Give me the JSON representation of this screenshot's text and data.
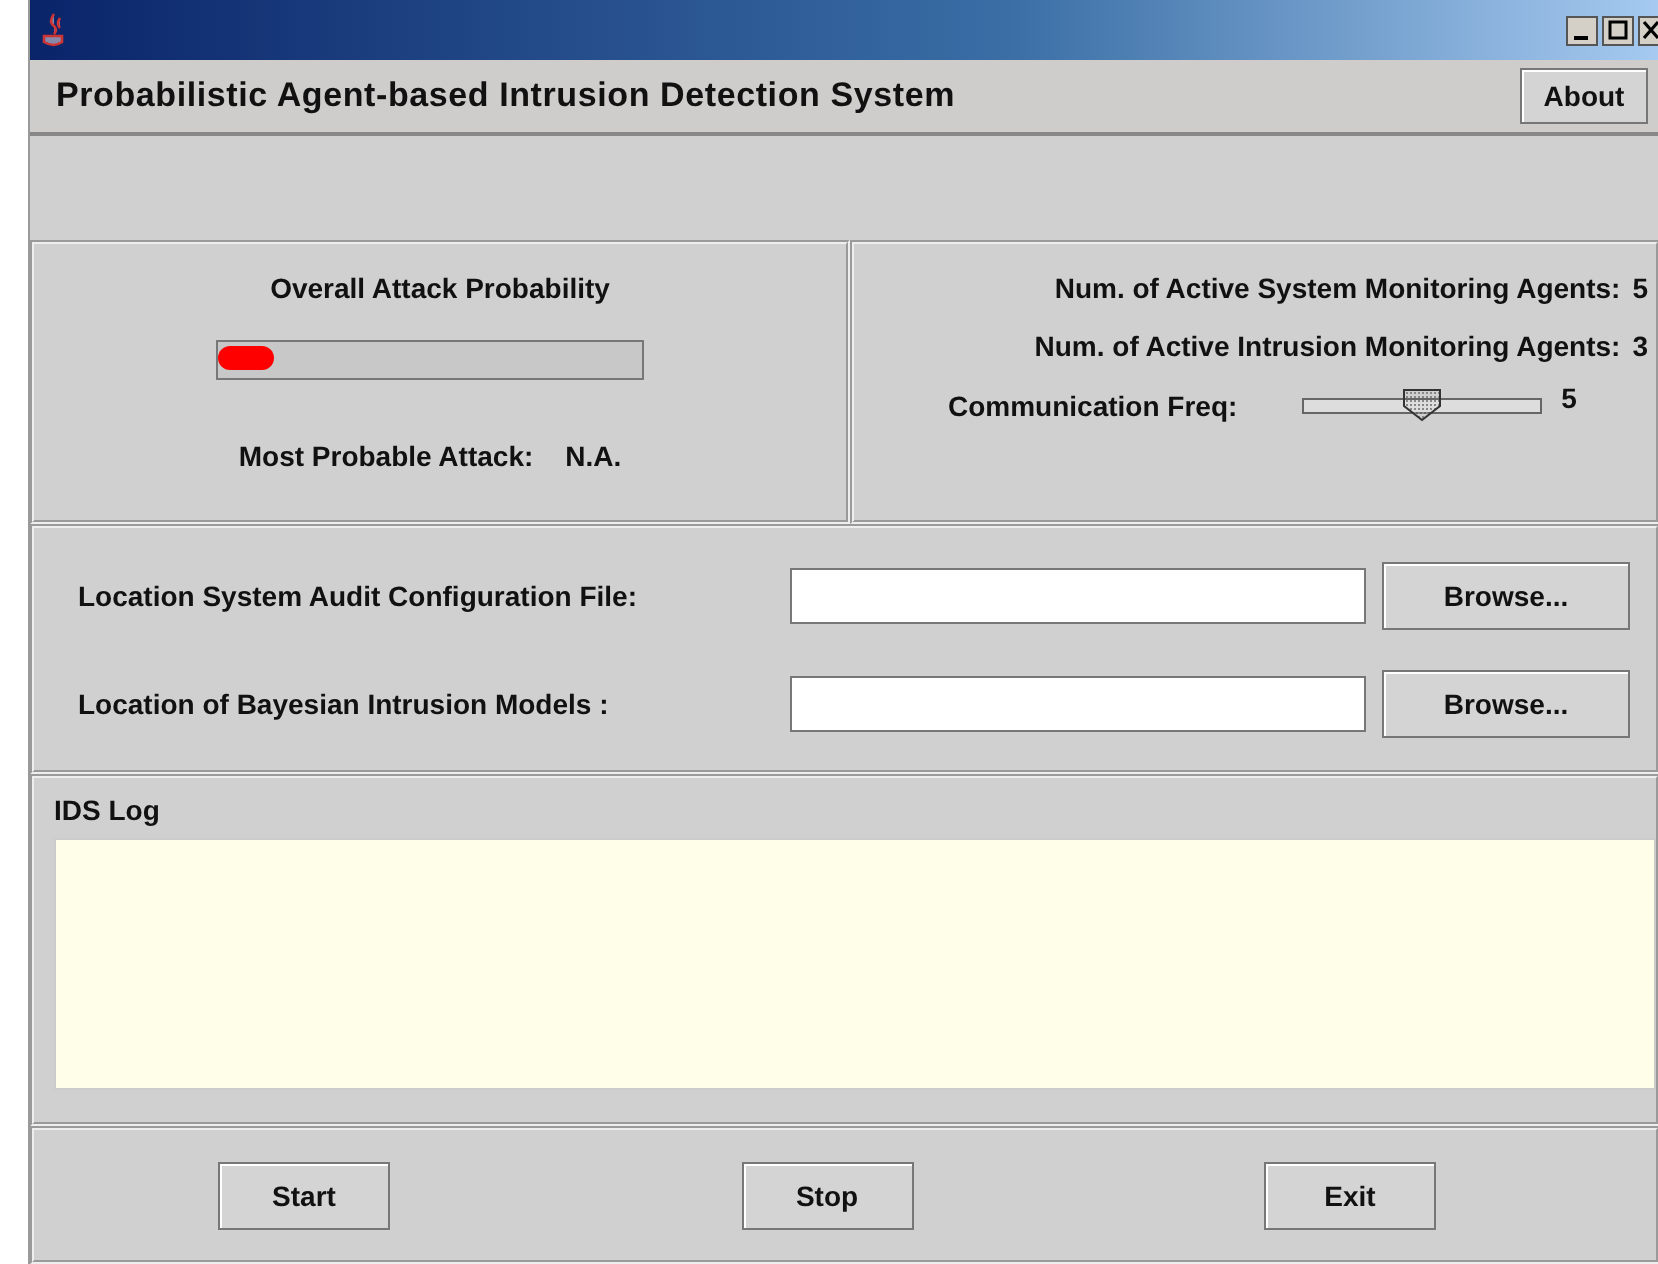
{
  "header": {
    "title": "Probabilistic Agent-based Intrusion Detection System",
    "about_button": "About"
  },
  "probability_panel": {
    "label": "Overall Attack Probability",
    "level": 0.13,
    "attack_label": "Most Probable Attack:",
    "attack_value": "N.A."
  },
  "agents_panel": {
    "system_agents_label": "Num. of Active System Monitoring Agents:",
    "system_agents_value": "5",
    "intrusion_agents_label": "Num. of Active Intrusion Monitoring Agents:",
    "intrusion_agents_value": "3",
    "frequency_label": "Communication Freq:",
    "frequency": {
      "level": 0.5
    },
    "frequency_value": "5"
  },
  "files": [
    {
      "label": "Location System Audit Configuration File:",
      "button": "Browse..."
    },
    {
      "label": "Location of Bayesian Intrusion Models :",
      "button": "Browse..."
    }
  ],
  "log": {
    "title": "IDS Log"
  },
  "buttons": [
    "Start",
    "Stop",
    "Exit"
  ]
}
